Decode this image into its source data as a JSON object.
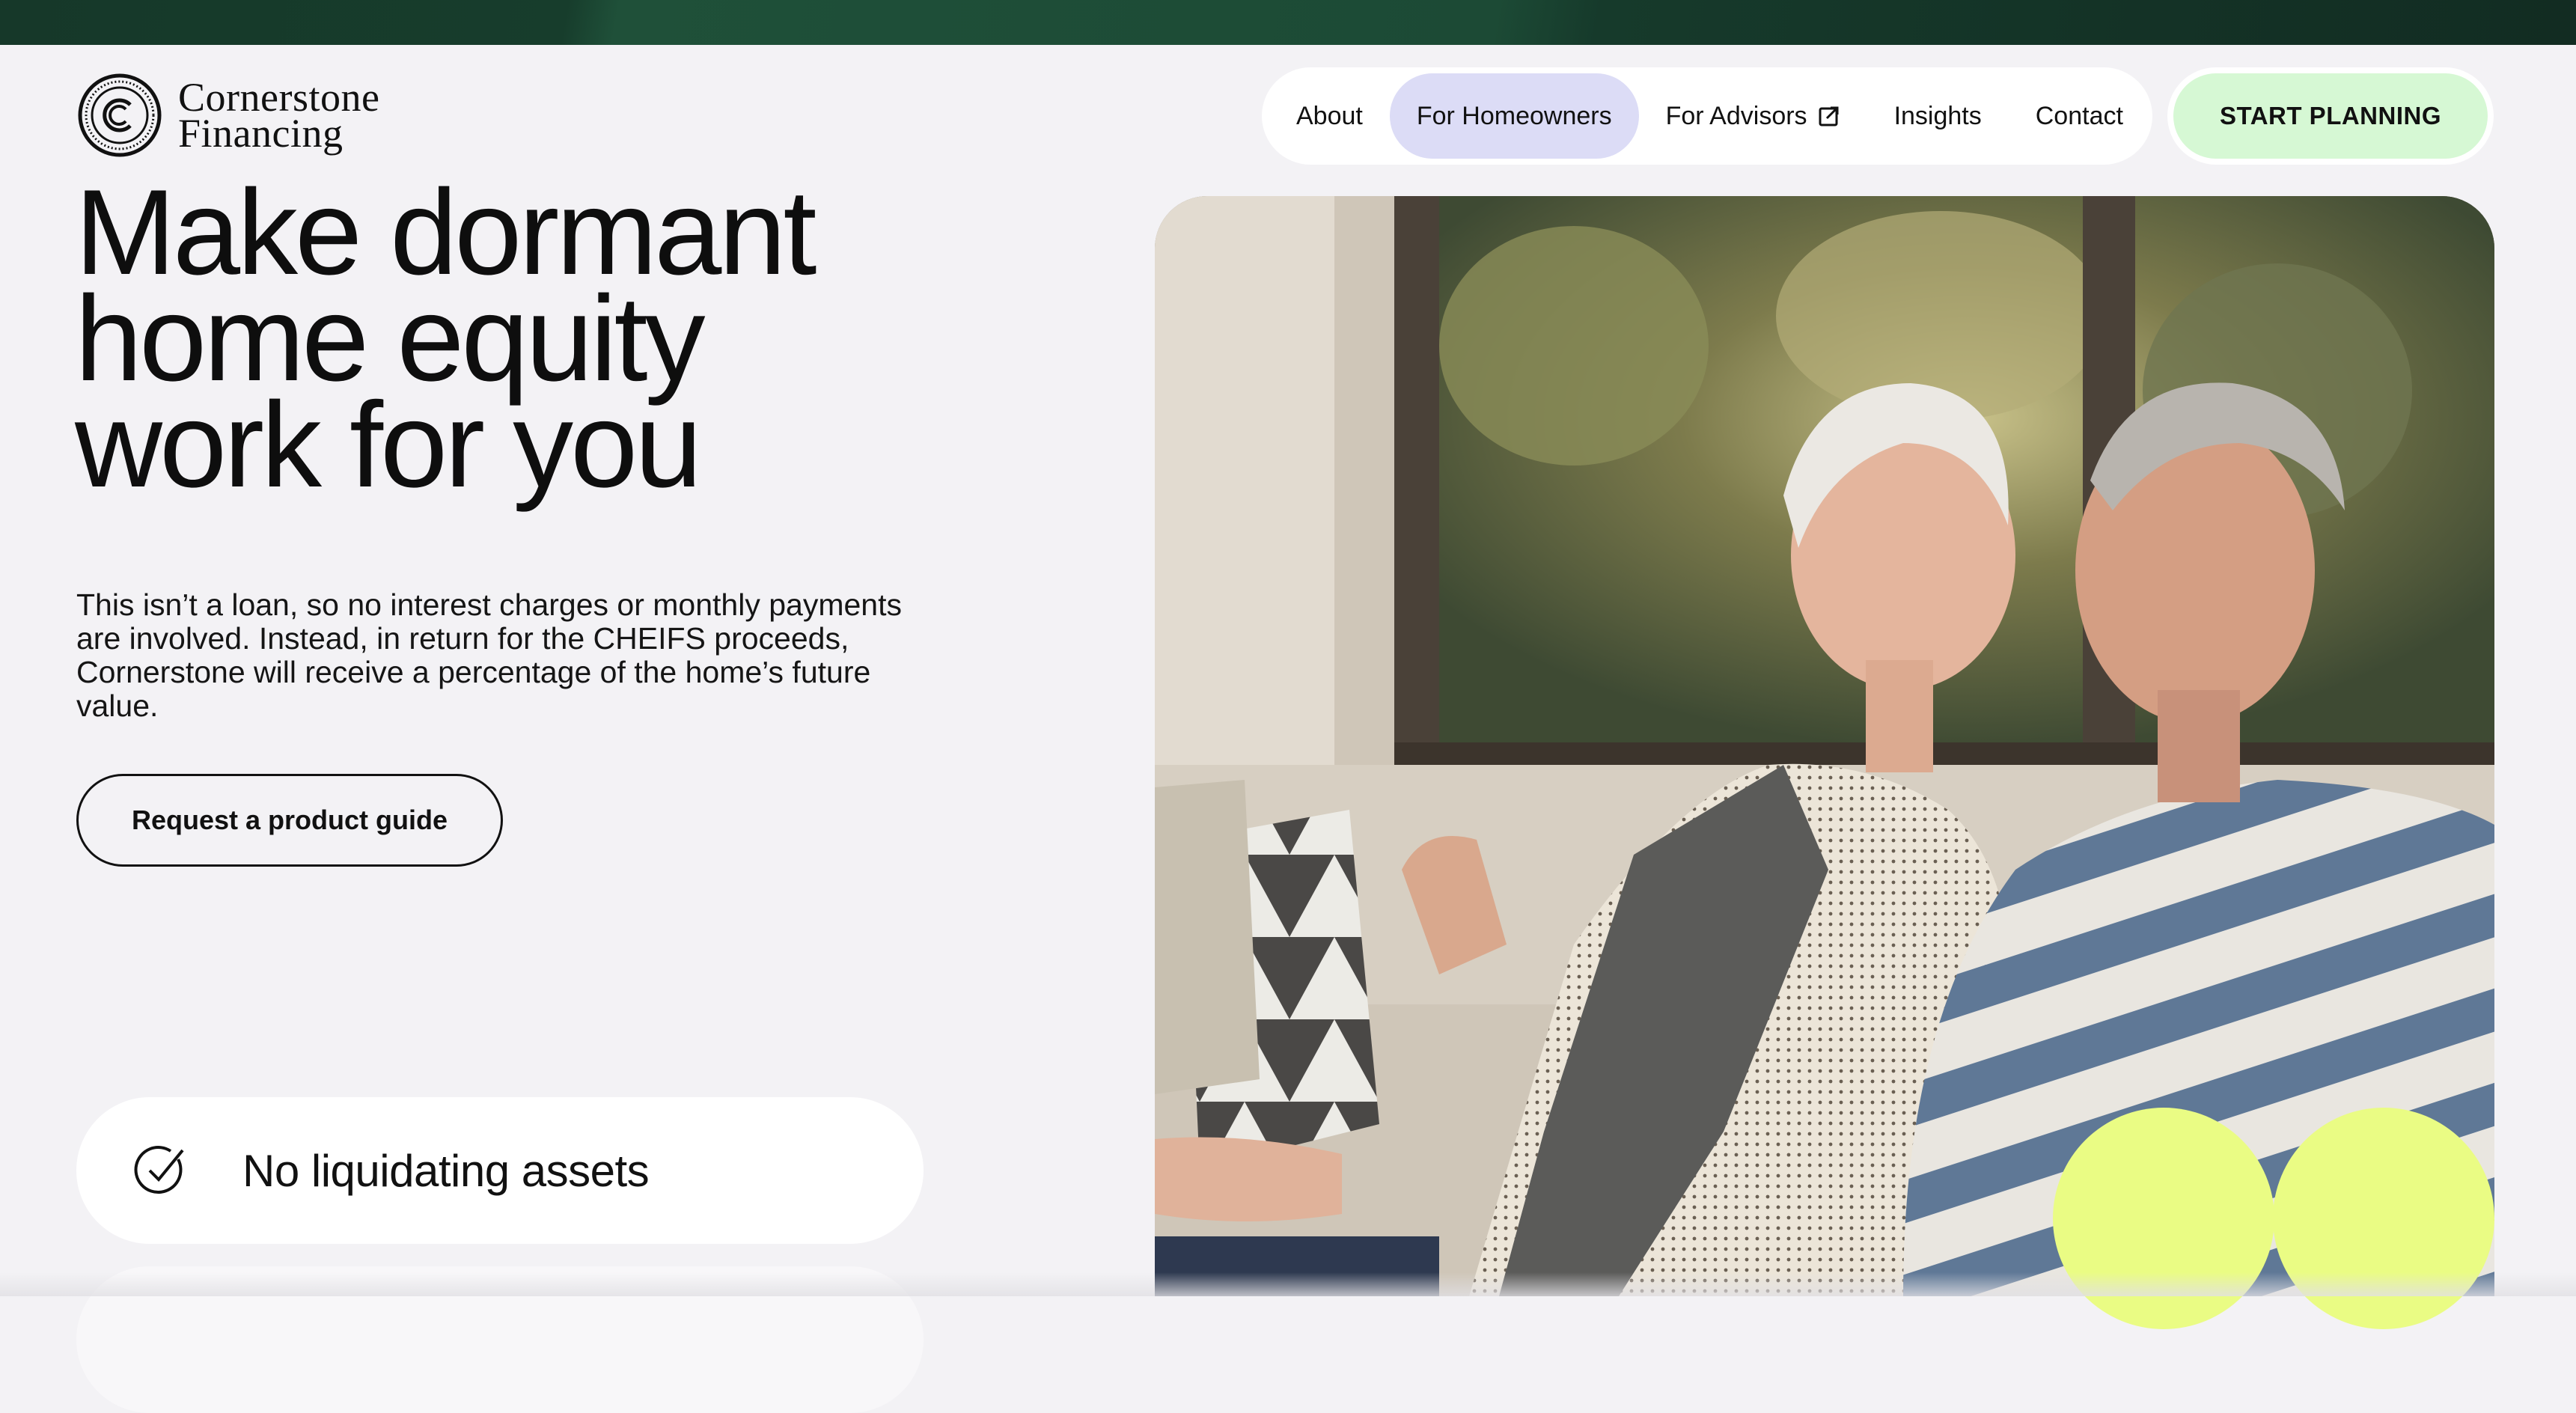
{
  "brand": {
    "name_line1": "Cornerstone",
    "name_line2": "Financing"
  },
  "nav": {
    "items": [
      {
        "label": "About"
      },
      {
        "label": "For Homeowners",
        "active": true
      },
      {
        "label": "For Advisors",
        "external": true
      },
      {
        "label": "Insights"
      },
      {
        "label": "Contact"
      }
    ],
    "cta_label": "START PLANNING"
  },
  "hero": {
    "headline_line1": "Make dormant",
    "headline_line2": "home equity",
    "headline_line3": "work for you",
    "body": "This isn’t a loan, so no interest charges or monthly payments are involved. Instead, in return for the CHEIFS proceeds, Cornerstone will receive a percentage of the home’s future value.",
    "guide_button": "Request a product guide"
  },
  "features": [
    {
      "label": "No liquidating assets",
      "icon": "check-circle-icon"
    }
  ],
  "colors": {
    "top_bar": "#163829",
    "page_bg": "#f3f2f5",
    "nav_active": "#dcdcf6",
    "cta_bg": "#d6f8d4",
    "accent_blob": "#eafc84"
  },
  "photo": {
    "subject": "older-couple-on-sofa-photo"
  }
}
